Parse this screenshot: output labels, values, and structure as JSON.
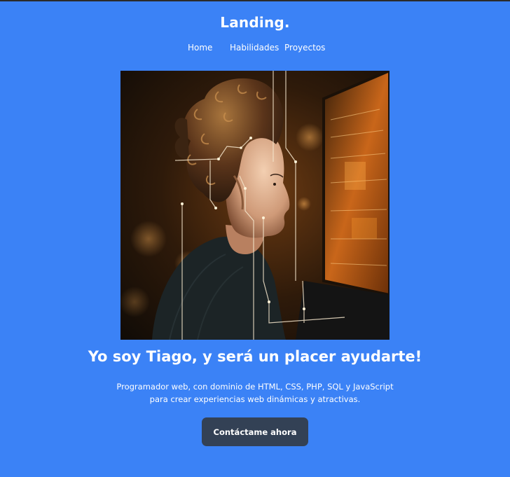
{
  "header": {
    "brand": "Landing.",
    "nav": [
      {
        "label": "Home"
      },
      {
        "label": "Habilidades"
      },
      {
        "label": "Proyectos"
      }
    ]
  },
  "hero": {
    "image_alt": "woman-looking-at-computer-screen-illustration",
    "headline": "Yo soy Tiago, y será un placer ayudarte!",
    "description_line1": "Programador web, con dominio de HTML, CSS, PHP, SQL y JavaScript",
    "description_line2": "para crear experiencias web dinámicas y atractivas.",
    "cta_label": "Contáctame ahora"
  },
  "colors": {
    "background": "#3b82f6",
    "button": "#334155",
    "text": "#ffffff"
  }
}
